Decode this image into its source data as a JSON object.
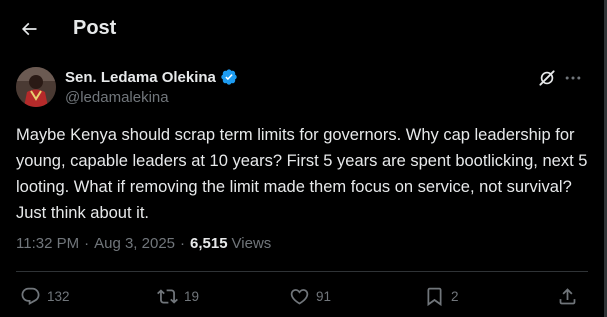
{
  "header": {
    "title": "Post",
    "back_icon": "arrow-left-icon"
  },
  "author": {
    "name": "Sen. Ledama Olekina",
    "handle": "@ledamalekina",
    "verified_color": "#1d9bf0"
  },
  "post": {
    "text": "Maybe Kenya should scrap term limits for governors. Why cap leadership for young, capable leaders at 10 years? First 5 years are spent bootlicking, next 5 looting. What if removing the limit made them focus on service, not survival? Just think about it.",
    "time": "11:32 PM",
    "separator": "·",
    "date": "Aug 3, 2025",
    "views_count": "6,515",
    "views_label": "Views"
  },
  "actions": {
    "replies": "132",
    "reposts": "19",
    "likes": "91",
    "bookmarks": "2"
  },
  "colors": {
    "background": "#000000",
    "text": "#e7e9ea",
    "muted": "#71767b",
    "border": "#2f3336"
  }
}
